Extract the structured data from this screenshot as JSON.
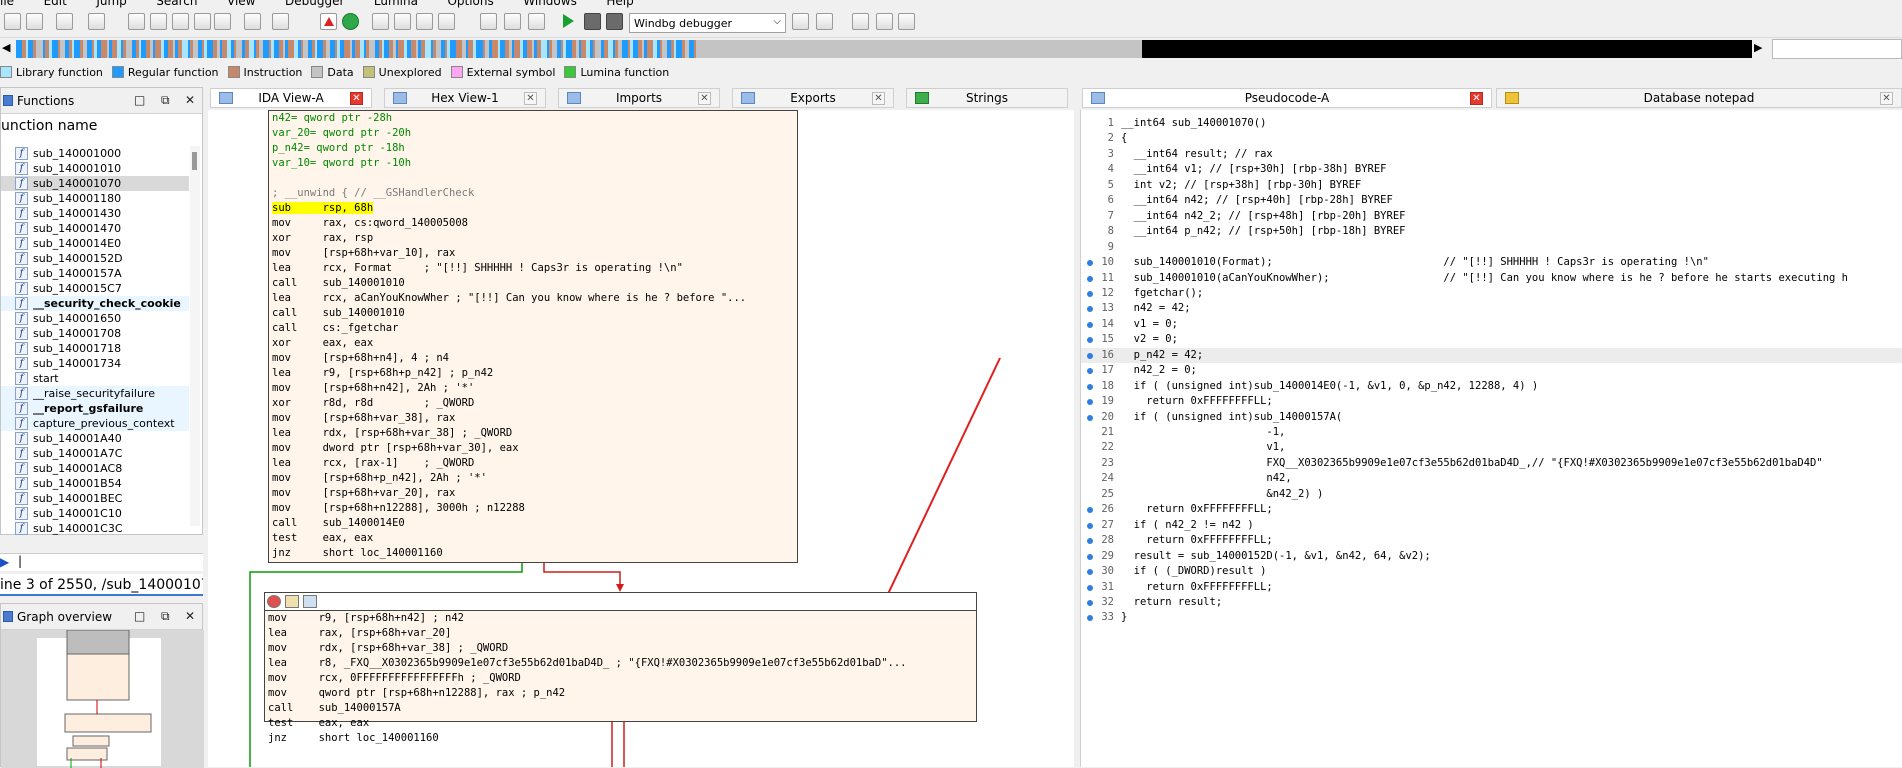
{
  "menu": [
    "ile",
    "Edit",
    "Jump",
    "Search",
    "View",
    "Debugger",
    "Lumina",
    "Options",
    "Windows",
    "Help"
  ],
  "toolbar": {
    "debugger_select": "Windbg debugger"
  },
  "legend": [
    {
      "label": "Library function",
      "color": "#a8e6ff"
    },
    {
      "label": "Regular function",
      "color": "#1e9bff"
    },
    {
      "label": "Instruction",
      "color": "#c8886a"
    },
    {
      "label": "Data",
      "color": "#c4c4c4"
    },
    {
      "label": "Unexplored",
      "color": "#c2c27a"
    },
    {
      "label": "External symbol",
      "color": "#ffa6f4"
    },
    {
      "label": "Lumina function",
      "color": "#38c838"
    }
  ],
  "functions_panel": {
    "title": "Functions",
    "column_header": "unction name",
    "items": [
      {
        "name": "sub_140001000",
        "style": "normal"
      },
      {
        "name": "sub_140001010",
        "style": "normal"
      },
      {
        "name": "sub_140001070",
        "style": "selected"
      },
      {
        "name": "sub_140001180",
        "style": "normal"
      },
      {
        "name": "sub_140001430",
        "style": "normal"
      },
      {
        "name": "sub_140001470",
        "style": "normal"
      },
      {
        "name": "sub_1400014E0",
        "style": "normal"
      },
      {
        "name": "sub_14000152D",
        "style": "normal"
      },
      {
        "name": "sub_14000157A",
        "style": "normal"
      },
      {
        "name": "sub_1400015C7",
        "style": "normal"
      },
      {
        "name": "__security_check_cookie",
        "style": "lib-bold"
      },
      {
        "name": "sub_140001650",
        "style": "normal"
      },
      {
        "name": "sub_140001708",
        "style": "normal"
      },
      {
        "name": "sub_140001718",
        "style": "normal"
      },
      {
        "name": "sub_140001734",
        "style": "normal"
      },
      {
        "name": "start",
        "style": "normal"
      },
      {
        "name": "__raise_securityfailure",
        "style": "lib"
      },
      {
        "name": "__report_gsfailure",
        "style": "lib-bold"
      },
      {
        "name": "capture_previous_context",
        "style": "lib"
      },
      {
        "name": "sub_140001A40",
        "style": "normal"
      },
      {
        "name": "sub_140001A7C",
        "style": "normal"
      },
      {
        "name": "sub_140001AC8",
        "style": "normal"
      },
      {
        "name": "sub_140001B54",
        "style": "normal"
      },
      {
        "name": "sub_140001BEC",
        "style": "normal"
      },
      {
        "name": "sub_140001C10",
        "style": "normal"
      },
      {
        "name": "sub_140001C3C",
        "style": "normal"
      }
    ],
    "line_info": "ine 3 of 2550, /sub_14000107"
  },
  "graph_overview": {
    "title": "Graph overview"
  },
  "tabs": {
    "ida_view": "IDA View-A",
    "hex_view": "Hex View-1",
    "imports": "Imports",
    "exports": "Exports",
    "strings": "Strings",
    "pseudocode": "Pseudocode-A",
    "notepad": "Database notepad"
  },
  "ida": {
    "block1": [
      "n42= qword ptr -28h",
      "var_20= qword ptr -20h",
      "p_n42= qword ptr -18h",
      "var_10= qword ptr -10h",
      "",
      "; __unwind { // __GSHandlerCheck",
      "sub     rsp, 68h",
      "mov     rax, cs:qword_140005008",
      "xor     rax, rsp",
      "mov     [rsp+68h+var_10], rax",
      "lea     rcx, Format     ; \"[!!] SHHHHH ! Caps3r is operating !\\n\"",
      "call    sub_140001010",
      "lea     rcx, aCanYouKnowWher ; \"[!!] Can you know where is he ? before \"...",
      "call    sub_140001010",
      "call    cs:_fgetchar",
      "xor     eax, eax",
      "mov     [rsp+68h+n4], 4 ; n4",
      "lea     r9, [rsp+68h+p_n42] ; p_n42",
      "mov     [rsp+68h+n42], 2Ah ; '*'",
      "xor     r8d, r8d        ; _QWORD",
      "mov     [rsp+68h+var_38], rax",
      "lea     rdx, [rsp+68h+var_38] ; _QWORD",
      "mov     dword ptr [rsp+68h+var_30], eax",
      "lea     rcx, [rax-1]    ; _QWORD",
      "mov     [rsp+68h+p_n42], 2Ah ; '*'",
      "mov     [rsp+68h+var_20], rax",
      "mov     [rsp+68h+n12288], 3000h ; n12288",
      "call    sub_1400014E0",
      "test    eax, eax",
      "jnz     short loc_140001160"
    ],
    "block2": [
      "mov     r9, [rsp+68h+n42] ; n42",
      "lea     rax, [rsp+68h+var_20]",
      "mov     rdx, [rsp+68h+var_38] ; _QWORD",
      "lea     r8, _FXQ__X0302365b9909e1e07cf3e55b62d01baD4D_ ; \"{FXQ!#X0302365b9909e1e07cf3e55b62d01baD\"...",
      "mov     rcx, 0FFFFFFFFFFFFFFFFh ; _QWORD",
      "mov     qword ptr [rsp+68h+n12288], rax ; p_n42",
      "call    sub_14000157A",
      "test    eax, eax",
      "jnz     short loc_140001160"
    ]
  },
  "pseudocode": [
    {
      "n": "1",
      "dot": false,
      "t": "__int64 sub_140001070()"
    },
    {
      "n": "2",
      "dot": false,
      "t": "{"
    },
    {
      "n": "3",
      "dot": false,
      "t": "  __int64 result; // rax"
    },
    {
      "n": "4",
      "dot": false,
      "t": "  __int64 v1; // [rsp+30h] [rbp-38h] BYREF"
    },
    {
      "n": "5",
      "dot": false,
      "t": "  int v2; // [rsp+38h] [rbp-30h] BYREF"
    },
    {
      "n": "6",
      "dot": false,
      "t": "  __int64 n42; // [rsp+40h] [rbp-28h] BYREF"
    },
    {
      "n": "7",
      "dot": false,
      "t": "  __int64 n42_2; // [rsp+48h] [rbp-20h] BYREF"
    },
    {
      "n": "8",
      "dot": false,
      "t": "  __int64 p_n42; // [rsp+50h] [rbp-18h] BYREF"
    },
    {
      "n": "9",
      "dot": false,
      "t": ""
    },
    {
      "n": "10",
      "dot": true,
      "t": "  sub_140001010(Format);                           // \"[!!] SHHHHH ! Caps3r is operating !\\n\""
    },
    {
      "n": "11",
      "dot": true,
      "t": "  sub_140001010(aCanYouKnowWher);                  // \"[!!] Can you know where is he ? before he starts executing h"
    },
    {
      "n": "12",
      "dot": true,
      "t": "  fgetchar();"
    },
    {
      "n": "13",
      "dot": true,
      "t": "  n42 = 42;"
    },
    {
      "n": "14",
      "dot": true,
      "t": "  v1 = 0;"
    },
    {
      "n": "15",
      "dot": true,
      "t": "  v2 = 0;"
    },
    {
      "n": "16",
      "dot": true,
      "t": "  p_n42 = 42;",
      "cur": true
    },
    {
      "n": "17",
      "dot": true,
      "t": "  n42_2 = 0;"
    },
    {
      "n": "18",
      "dot": true,
      "t": "  if ( (unsigned int)sub_1400014E0(-1, &v1, 0, &p_n42, 12288, 4) )"
    },
    {
      "n": "19",
      "dot": true,
      "t": "    return 0xFFFFFFFFLL;"
    },
    {
      "n": "20",
      "dot": true,
      "t": "  if ( (unsigned int)sub_14000157A("
    },
    {
      "n": "21",
      "dot": false,
      "t": "                       -1,"
    },
    {
      "n": "22",
      "dot": false,
      "t": "                       v1,"
    },
    {
      "n": "23",
      "dot": false,
      "t": "                       FXQ__X0302365b9909e1e07cf3e55b62d01baD4D_,// \"{FXQ!#X0302365b9909e1e07cf3e55b62d01baD4D\""
    },
    {
      "n": "24",
      "dot": false,
      "t": "                       n42,"
    },
    {
      "n": "25",
      "dot": false,
      "t": "                       &n42_2) )"
    },
    {
      "n": "26",
      "dot": true,
      "t": "    return 0xFFFFFFFFLL;"
    },
    {
      "n": "27",
      "dot": true,
      "t": "  if ( n42_2 != n42 )"
    },
    {
      "n": "28",
      "dot": true,
      "t": "    return 0xFFFFFFFFLL;"
    },
    {
      "n": "29",
      "dot": true,
      "t": "  result = sub_14000152D(-1, &v1, &n42, 64, &v2);"
    },
    {
      "n": "30",
      "dot": true,
      "t": "  if ( (_DWORD)result )"
    },
    {
      "n": "31",
      "dot": true,
      "t": "    return 0xFFFFFFFFLL;"
    },
    {
      "n": "32",
      "dot": true,
      "t": "  return result;"
    },
    {
      "n": "33",
      "dot": true,
      "t": "}"
    }
  ]
}
